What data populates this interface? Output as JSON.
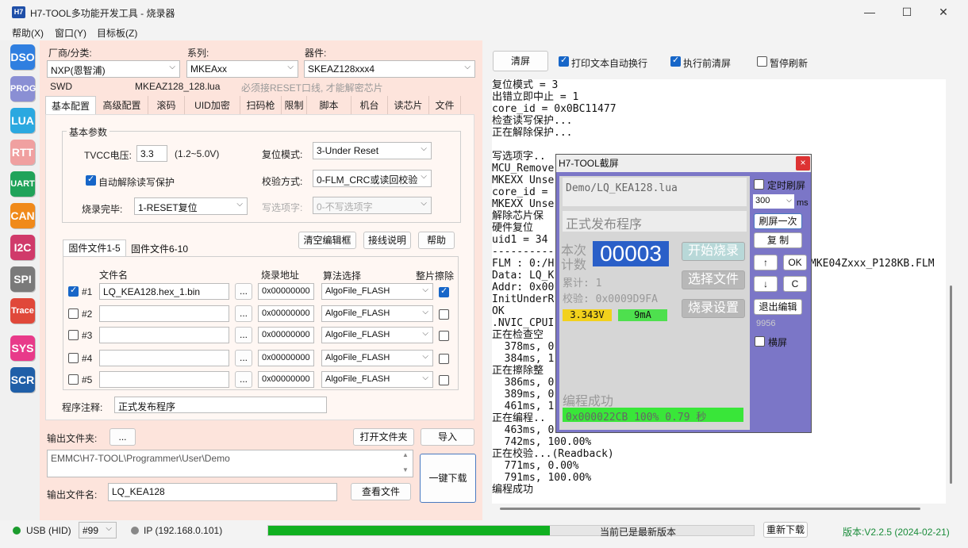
{
  "window": {
    "title": "H7-TOOL多功能开发工具 - 烧录器",
    "logo": "H7"
  },
  "menu": [
    "帮助(X)",
    "窗口(Y)",
    "目标板(Z)"
  ],
  "sidebar": [
    {
      "label": "DSO",
      "color": "#2f7fe0"
    },
    {
      "label": "PROG",
      "color": "#8a8fd4"
    },
    {
      "label": "LUA",
      "color": "#2aa8e0"
    },
    {
      "label": "RTT",
      "color": "#f0a0a0"
    },
    {
      "label": "UART",
      "color": "#1fa35a"
    },
    {
      "label": "CAN",
      "color": "#f08a1a"
    },
    {
      "label": "I2C",
      "color": "#d03a6a"
    },
    {
      "label": "SPI",
      "color": "#7a7a7a"
    },
    {
      "label": "Trace",
      "color": "#e0483a"
    },
    {
      "label": "SYS",
      "color": "#e83a8a"
    },
    {
      "label": "SCR",
      "color": "#1f5fa8"
    }
  ],
  "config": {
    "vendor_label": "厂商/分类:",
    "vendor_value": "NXP(恩智浦)",
    "series_label": "系列:",
    "series_value": "MKEAxx",
    "device_label": "器件:",
    "device_value": "SKEAZ128xxx4",
    "iface": "SWD",
    "lua_file": "MKEAZ128_128.lua",
    "note": "必须接RESET口线, 才能解密芯片",
    "tabs": [
      "基本配置",
      "高级配置",
      "滚码",
      "UID加密",
      "扫码枪",
      "限制",
      "脚本",
      "机台",
      "读芯片",
      "文件"
    ],
    "group_title": "基本参数",
    "tvcc_label": "TVCC电压:",
    "tvcc_value": "3.3",
    "tvcc_range": "(1.2~5.0V)",
    "reset_label": "复位模式:",
    "reset_value": "3-Under Reset",
    "auto_unlock_label": "自动解除读写保护",
    "verify_label": "校验方式:",
    "verify_value": "0-FLM_CRC或读回校验",
    "done_label": "烧录完毕:",
    "done_value": "1-RESET复位",
    "option_label": "写选项字:",
    "option_value": "0-不写选项字",
    "fw_tabs": [
      "固件文件1-5",
      "固件文件6-10"
    ],
    "clear_btn": "清空编辑框",
    "wiring_btn": "接线说明",
    "help_btn": "帮助",
    "col_file": "文件名",
    "col_addr": "烧录地址",
    "col_algo": "算法选择",
    "col_erase": "整片擦除",
    "rows": [
      {
        "id": "#1",
        "file": "LQ_KEA128.hex_1.bin",
        "addr": "0x00000000",
        "algo": "AlgoFile_FLASH",
        "checked": true,
        "erase": true
      },
      {
        "id": "#2",
        "file": "",
        "addr": "0x00000000",
        "algo": "AlgoFile_FLASH",
        "checked": false,
        "erase": false
      },
      {
        "id": "#3",
        "file": "",
        "addr": "0x00000000",
        "algo": "AlgoFile_FLASH",
        "checked": false,
        "erase": false
      },
      {
        "id": "#4",
        "file": "",
        "addr": "0x00000000",
        "algo": "AlgoFile_FLASH",
        "checked": false,
        "erase": false
      },
      {
        "id": "#5",
        "file": "",
        "addr": "0x00000000",
        "algo": "AlgoFile_FLASH",
        "checked": false,
        "erase": false
      }
    ],
    "browse": "...",
    "comment_label": "程序注释:",
    "comment_value": "正式发布程序",
    "outdir_label": "输出文件夹:",
    "outdir_btn": "...",
    "open_dir_btn": "打开文件夹",
    "import_btn": "导入",
    "outdir_path": "EMMC\\H7-TOOL\\Programmer\\User\\Demo",
    "onekey_btn": "一键下载",
    "outname_label": "输出文件名:",
    "outname_value": "LQ_KEA128",
    "view_file_btn": "查看文件"
  },
  "log_toolbar": {
    "clear": "清屏",
    "wrap": "打印文本自动换行",
    "clear_before": "执行前清屏",
    "pause": "暂停刷新"
  },
  "log_lines": [
    "复位模式 = 3",
    "出错立即中止 = 1",
    "core_id = 0x0BC11477",
    "检查读写保护...",
    "正在解除保护...",
    "",
    "写选项字..",
    "MCU_Remove",
    "MKEXX Unse",
    "core_id =",
    "MKEXX Unse",
    "解除芯片保",
    "硬件复位",
    "uid1 = 34",
    "-----------",
    "FLM : 0:/H",
    "Data: LQ_K",
    "Addr: 0x00",
    "InitUnderR",
    "OK",
    ".NVIC_CPUI",
    "正在检查空",
    "  378ms, 0",
    "  384ms, 1",
    "正在擦除整",
    "  386ms, 0",
    "  389ms, 0",
    "  461ms, 1",
    "正在编程..",
    "  463ms, 0.00%",
    "  742ms, 100.00%",
    "正在校验...(Readback)",
    "  771ms, 0.00%",
    "  791ms, 100.00%",
    "编程成功"
  ],
  "log_right_fragment": "MKE04Zxxx_P128KB.FLM",
  "popup": {
    "title": "H7-TOOL截屏",
    "close": "×",
    "file": "Demo/LQ_KEA128.lua",
    "comment": "正式发布程序",
    "count_label1": "本次",
    "count_label2": "计数",
    "count_value": "00003",
    "total": "累计: 1",
    "checksum": "校验: 0x0009D9FA",
    "voltage": "3.343V",
    "current": "9mA",
    "start_btn": "开始烧录",
    "select_btn": "选择文件",
    "settings_btn": "烧录设置",
    "status": "编程成功",
    "progress_text": "0x000022CB  100%  0.79 秒",
    "timer_label": "定时刷屏",
    "interval": "300",
    "ms": "ms",
    "refresh_once": "刷屏一次",
    "copy": "复 制",
    "up": "↑",
    "ok": "OK",
    "down": "↓",
    "c": "C",
    "exit_edit": "退出编辑",
    "num": "9956",
    "landscape": "横屏"
  },
  "status": {
    "usb": "USB (HID)",
    "slot": "#99",
    "ip": "IP (192.168.0.101)",
    "progress": 0.58,
    "version_msg": "当前已是最新版本",
    "redownload": "重新下载",
    "version": "版本:V2.2.5 (2024-02-21)"
  }
}
